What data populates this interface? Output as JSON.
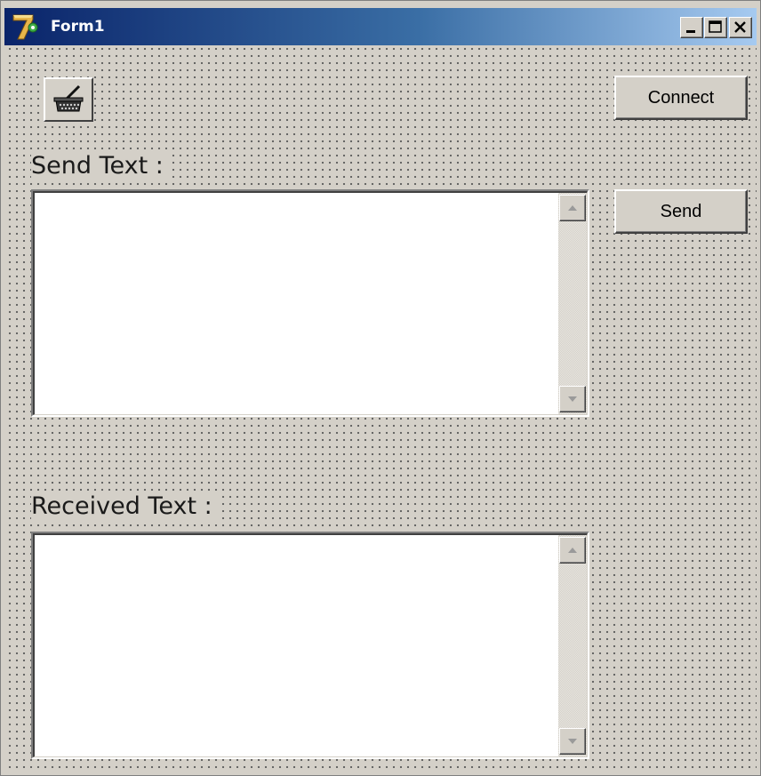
{
  "window": {
    "title": "Form1",
    "colors": {
      "titlebar_start": "#0a246a",
      "titlebar_end": "#a6caf0",
      "face": "#d4d0c8"
    },
    "caption_buttons": [
      "minimize-icon",
      "maximize-icon",
      "close-icon"
    ]
  },
  "toolbar": {
    "comm_button_icon": "serial-port-connector-icon"
  },
  "buttons": {
    "connect_label": "Connect",
    "send_label": "Send"
  },
  "send_section": {
    "label": "Send Text :",
    "text": ""
  },
  "received_section": {
    "label": "Received Text :",
    "text": ""
  }
}
